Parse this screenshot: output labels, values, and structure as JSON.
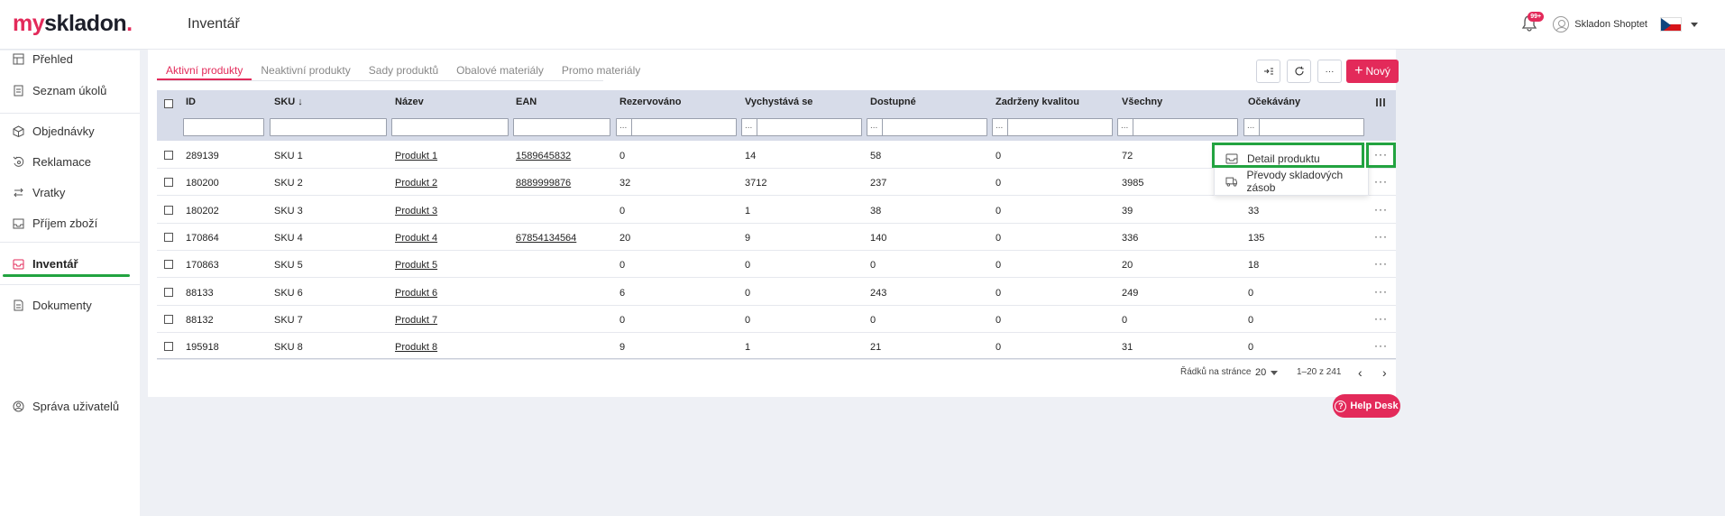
{
  "app": {
    "logo_my": "my",
    "logo_rest": "skladon",
    "logo_dot": ".",
    "page_title": "Inventář"
  },
  "topbar": {
    "notifications_badge": "99+",
    "user_name": "Skladon Shoptet",
    "language": "cs"
  },
  "sidebar": {
    "items": [
      {
        "label": "Přehled",
        "icon": "grid-icon"
      },
      {
        "label": "Seznam úkolů",
        "icon": "clipboard-icon"
      },
      {
        "label": "Objednávky",
        "icon": "box-icon"
      },
      {
        "label": "Reklamace",
        "icon": "return-icon"
      },
      {
        "label": "Vratky",
        "icon": "exchange-icon"
      },
      {
        "label": "Příjem zboží",
        "icon": "inbox-icon"
      },
      {
        "label": "Inventář",
        "icon": "inventory-icon",
        "active": true
      },
      {
        "label": "Dokumenty",
        "icon": "document-icon"
      }
    ],
    "bottom_item": {
      "label": "Správa uživatelů",
      "icon": "users-icon"
    }
  },
  "tabs": [
    {
      "label": "Aktivní produkty",
      "active": true
    },
    {
      "label": "Neaktivní produkty"
    },
    {
      "label": "Sady produktů"
    },
    {
      "label": "Obalové materiály"
    },
    {
      "label": "Promo materiály"
    }
  ],
  "toolbar": {
    "new_label": "Nový",
    "more_label": "···"
  },
  "table": {
    "columns": [
      "ID",
      "SKU",
      "Název",
      "EAN",
      "Rezervováno",
      "Vychystává se",
      "Dostupné",
      "Zadrženy kvalitou",
      "Všechny",
      "Očekávány"
    ],
    "range_placeholder": "...",
    "rows": [
      {
        "id": "289139",
        "sku": "SKU 1",
        "name": "Produkt 1",
        "ean": "1589645832",
        "reserved": "0",
        "picking": "14",
        "available": "58",
        "quality": "0",
        "all": "72",
        "expected": ""
      },
      {
        "id": "180200",
        "sku": "SKU 2",
        "name": "Produkt 2",
        "ean": "8889999876",
        "reserved": "32",
        "picking": "3712",
        "available": "237",
        "quality": "0",
        "all": "3985",
        "expected": ""
      },
      {
        "id": "180202",
        "sku": "SKU 3",
        "name": "Produkt 3",
        "ean": "",
        "reserved": "0",
        "picking": "1",
        "available": "38",
        "quality": "0",
        "all": "39",
        "expected": "33"
      },
      {
        "id": "170864",
        "sku": "SKU 4",
        "name": "Produkt 4",
        "ean": "67854134564",
        "reserved": "20",
        "picking": "9",
        "available": "140",
        "quality": "0",
        "all": "336",
        "expected": "135"
      },
      {
        "id": "170863",
        "sku": "SKU 5",
        "name": "Produkt 5",
        "ean": "",
        "reserved": "0",
        "picking": "0",
        "available": "0",
        "quality": "0",
        "all": "20",
        "expected": "18"
      },
      {
        "id": "88133",
        "sku": "SKU 6",
        "name": "Produkt 6",
        "ean": "",
        "reserved": "6",
        "picking": "0",
        "available": "243",
        "quality": "0",
        "all": "249",
        "expected": "0"
      },
      {
        "id": "88132",
        "sku": "SKU 7",
        "name": "Produkt 7",
        "ean": "",
        "reserved": "0",
        "picking": "0",
        "available": "0",
        "quality": "0",
        "all": "0",
        "expected": "0"
      },
      {
        "id": "195918",
        "sku": "SKU 8",
        "name": "Produkt 8",
        "ean": "",
        "reserved": "9",
        "picking": "1",
        "available": "21",
        "quality": "0",
        "all": "31",
        "expected": "0"
      }
    ],
    "row_more": "···"
  },
  "row_menu": {
    "detail_label": "Detail produktu",
    "transfers_label": "Převody skladových zásob"
  },
  "pagination": {
    "rows_per_page_label": "Řádků na stránce",
    "rows_per_page": "20",
    "range": "1–20 z 241"
  },
  "helpdesk": {
    "label": "Help Desk",
    "icon_glyph": "?"
  },
  "colors": {
    "brand": "#e32a5a",
    "highlight": "#22a340",
    "table_header": "#d7dce9"
  }
}
